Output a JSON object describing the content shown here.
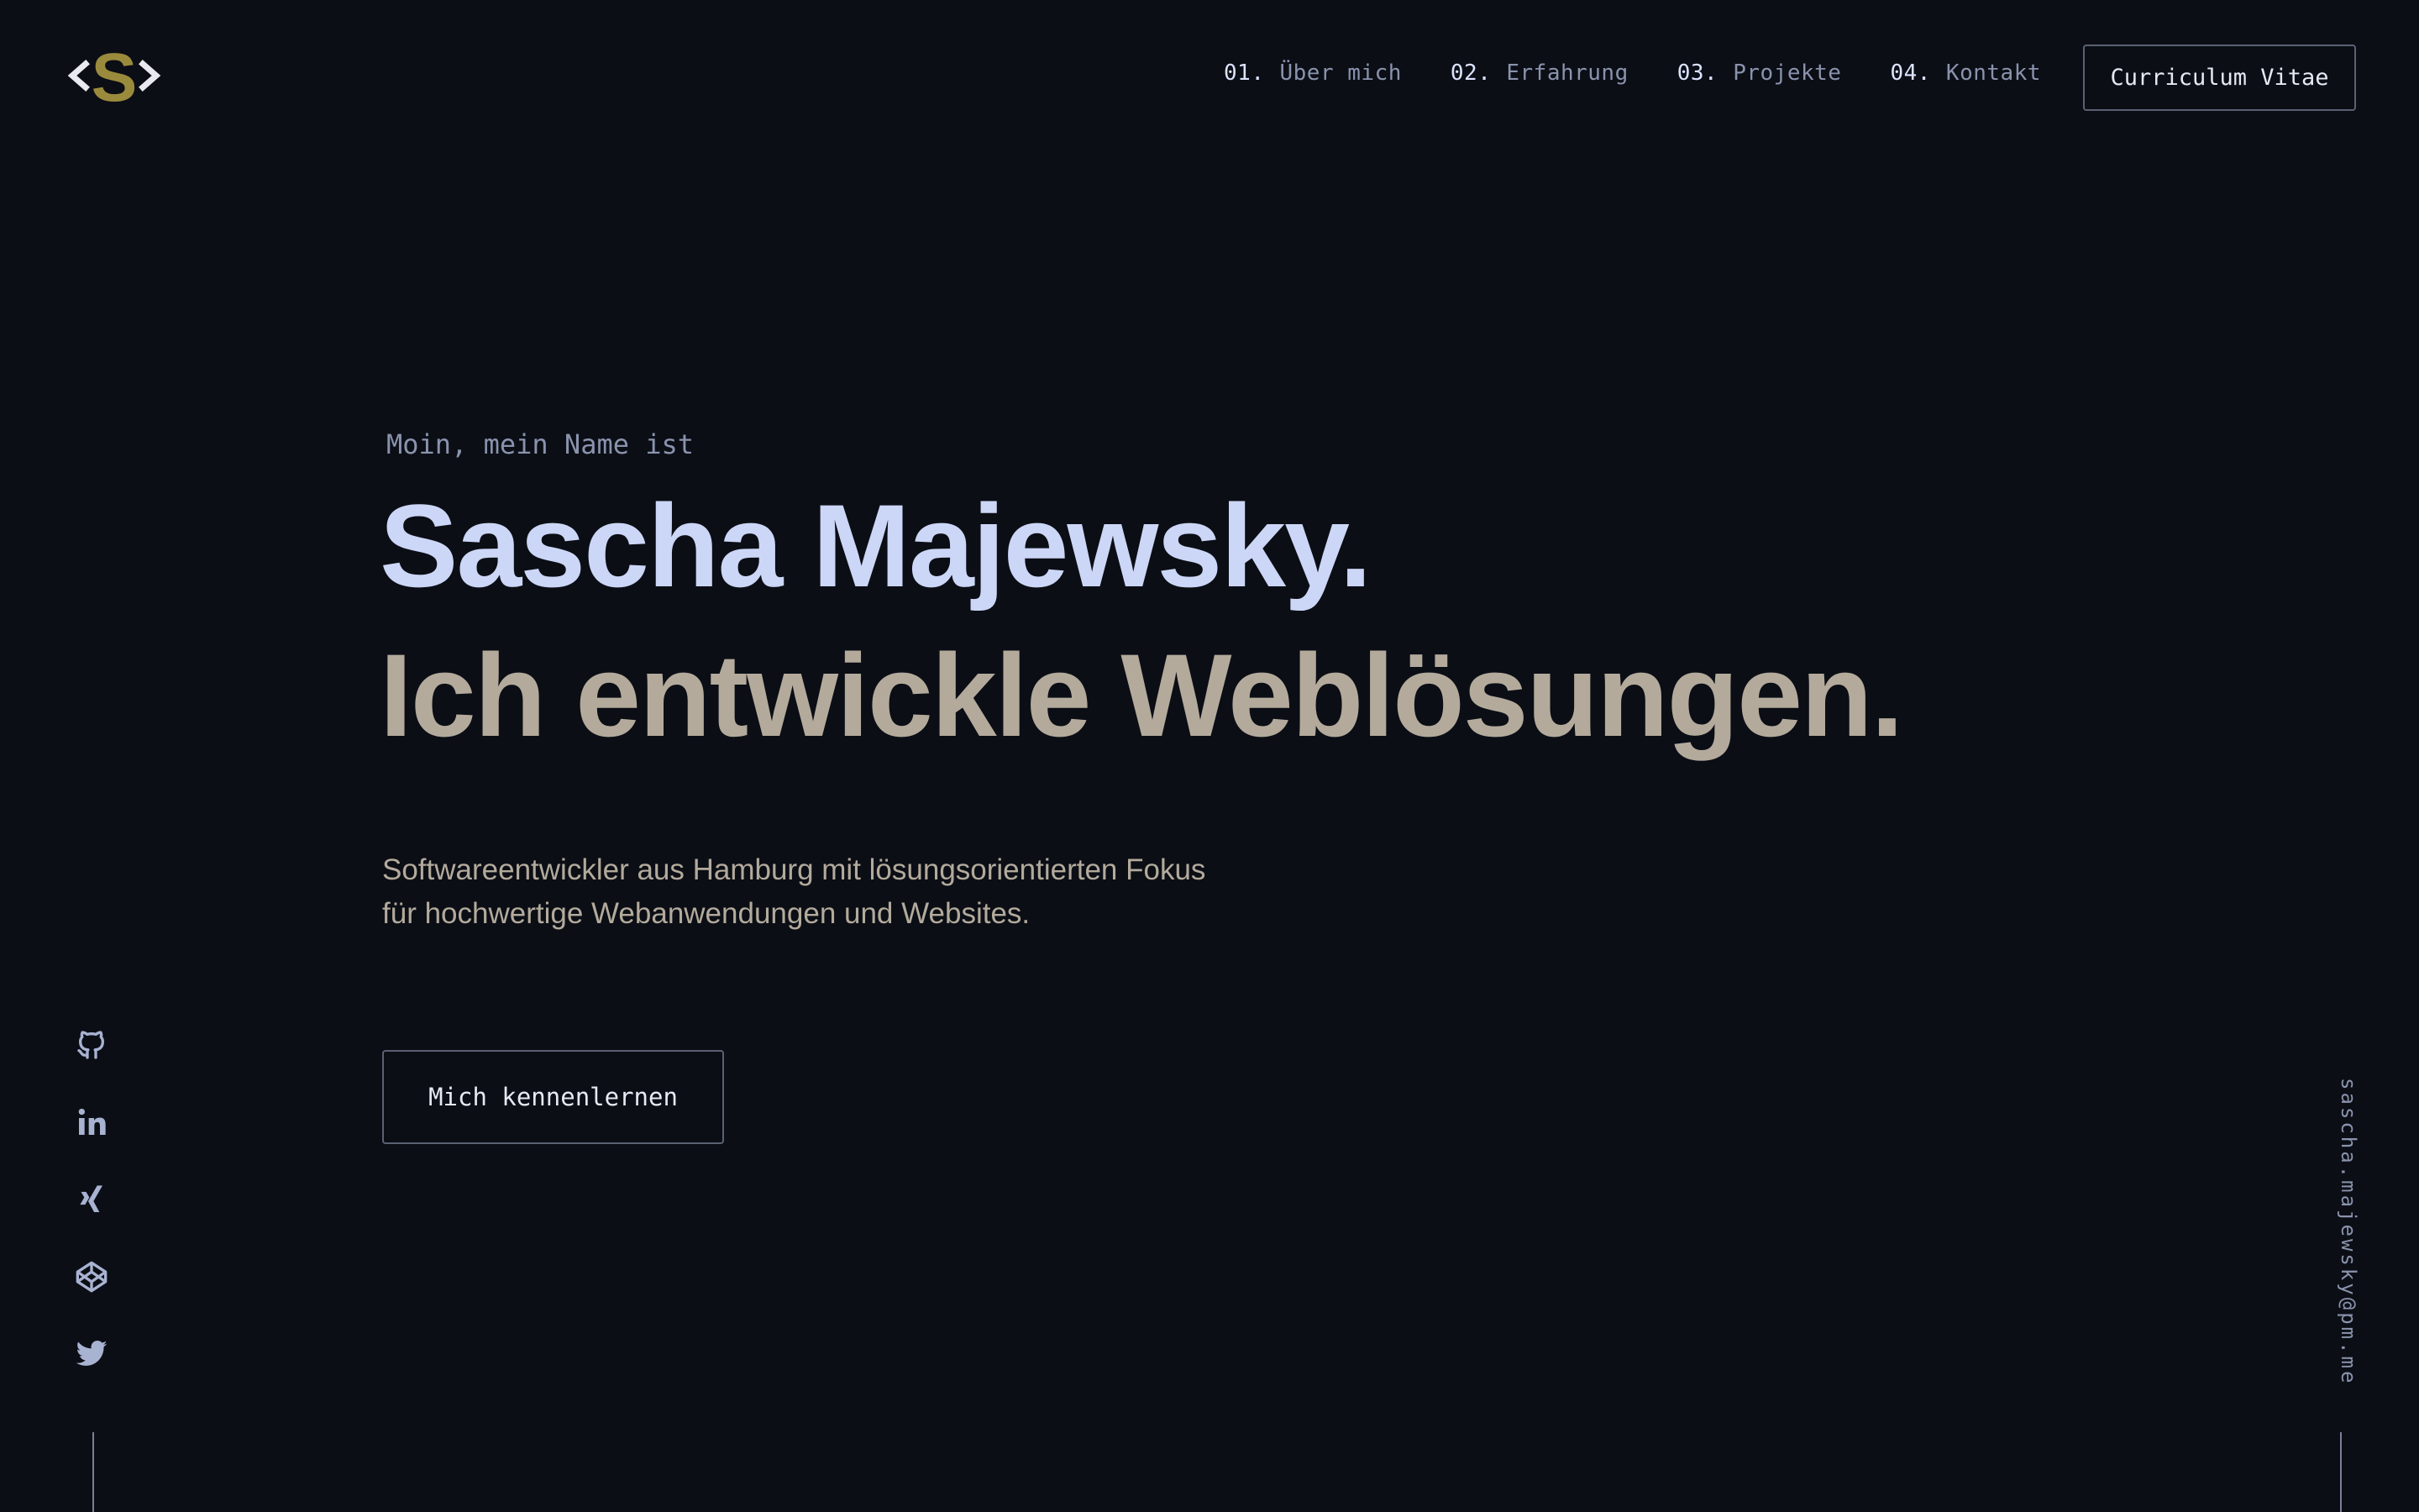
{
  "colors": {
    "background": "#0b0e15",
    "name_color": "#ccd6f6",
    "tagline_color": "#b3aa9c",
    "muted_text": "#8a93ad",
    "logo_accent": "#9a8a3c",
    "border": "#5b6173"
  },
  "logo": {
    "icon": "code-brackets-s-logo"
  },
  "nav": {
    "items": [
      {
        "num": "01.",
        "label": "Über mich"
      },
      {
        "num": "02.",
        "label": "Erfahrung"
      },
      {
        "num": "03.",
        "label": "Projekte"
      },
      {
        "num": "04.",
        "label": "Kontakt"
      }
    ],
    "cv_button": "Curriculum Vitae"
  },
  "hero": {
    "greeting": "Moin, mein Name ist",
    "name": "Sascha Majewsky.",
    "tagline": "Ich entwickle Weblösungen.",
    "description": [
      "Softwareentwickler aus Hamburg mit lösungsorientierten Fokus",
      "für hochwertige Webanwendungen und Websites."
    ],
    "cta": "Mich kennenlernen"
  },
  "social": {
    "icons": [
      "github-icon",
      "linkedin-icon",
      "xing-icon",
      "codepen-icon",
      "twitter-icon"
    ]
  },
  "email": "sascha.majewsky@pm.me"
}
